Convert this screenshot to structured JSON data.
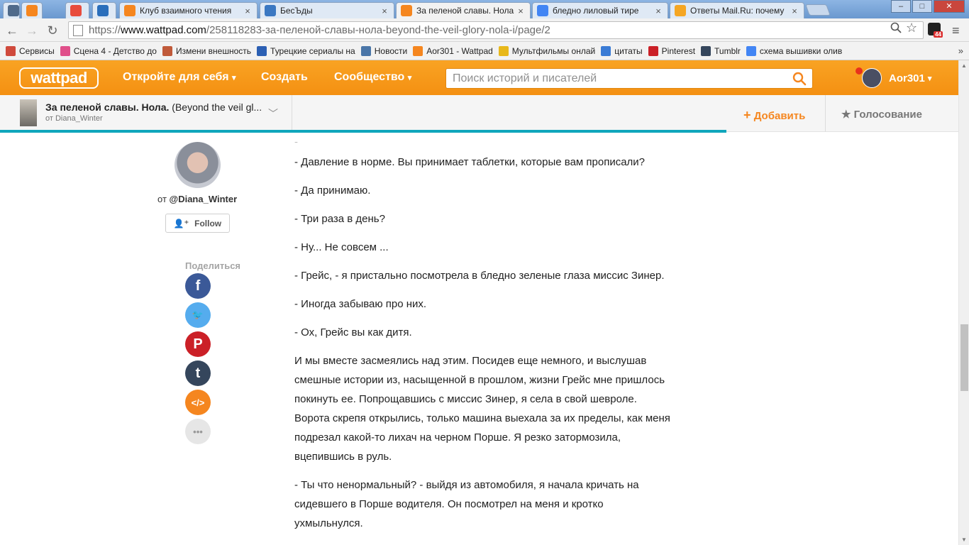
{
  "tabs": [
    {
      "label": "",
      "icon": "da-icon",
      "color": "#4f6a8a"
    },
    {
      "label": "",
      "icon": "wattpad-tab-icon",
      "color": "#f5861f"
    },
    {
      "label": "",
      "icon": "5plus-icon",
      "color": "#e84c3d"
    },
    {
      "label": "",
      "icon": "feather-icon",
      "color": "#2a6ebb"
    },
    {
      "label": "Клуб взаимного чтения",
      "icon": "wattpad-tab-icon",
      "color": "#f5861f"
    },
    {
      "label": "БесЪды",
      "icon": "chat-icon",
      "color": "#3b78c2"
    },
    {
      "label": "За пеленой славы. Нола",
      "icon": "wattpad-tab-icon",
      "color": "#f5861f"
    },
    {
      "label": "бледно лиловый тире",
      "icon": "google-icon",
      "color": "#4285f4"
    },
    {
      "label": "Ответы Mail.Ru: почему",
      "icon": "question-icon",
      "color": "#f5a623"
    }
  ],
  "address": {
    "scheme": "https://",
    "host": "www.wattpad.com",
    "path": "/258118283-за-пеленой-славы-нола-beyond-the-veil-glory-nola-i/page/2"
  },
  "extension_badge": "44",
  "bookmarks": [
    {
      "label": "Сервисы",
      "icon": "apps-icon",
      "color": "#d04a3c"
    },
    {
      "label": "Сцена 4 - Детство до",
      "icon": "heart-icon",
      "color": "#e04f8a"
    },
    {
      "label": "Измени внешность",
      "icon": "cake-icon",
      "color": "#c05a3a"
    },
    {
      "label": "Турецкие сериалы на",
      "icon": "flame-icon",
      "color": "#2b5fb3"
    },
    {
      "label": "Новости",
      "icon": "vk-icon",
      "color": "#4a76a8"
    },
    {
      "label": "Aor301 - Wattpad",
      "icon": "wattpad-bm-icon",
      "color": "#f5861f"
    },
    {
      "label": "Мультфильмы онлай",
      "icon": "smile-icon",
      "color": "#e8b81a"
    },
    {
      "label": "цитаты",
      "icon": "quote-icon",
      "color": "#3a7bd5"
    },
    {
      "label": "Pinterest",
      "icon": "pinterest-icon",
      "color": "#cb2027"
    },
    {
      "label": "Tumblr",
      "icon": "tumblr-icon",
      "color": "#35465c"
    },
    {
      "label": "схема вышивки олив",
      "icon": "google-icon",
      "color": "#4285f4"
    }
  ],
  "wattpad": {
    "logo": "wattpad",
    "nav_discover": "Откройте для себя",
    "nav_create": "Создать",
    "nav_community": "Сообщество",
    "search_placeholder": "Поиск историй и писателей",
    "username": "Aor301",
    "brand_color": "#f5861f"
  },
  "story": {
    "title_bold": "За пеленой славы. Нола.",
    "title_rest": " (Beyond the veil gl...",
    "author_line": "от Diana_Winter",
    "add_label": "Добавить",
    "vote_label": "Голосование"
  },
  "sidebar": {
    "by_prefix": "от ",
    "author_handle": "@Diana_Winter",
    "follow_label": "Follow",
    "share_label": "Поделиться",
    "share_buttons": [
      {
        "icon": "facebook-icon",
        "glyph": "f",
        "color": "#3b5998"
      },
      {
        "icon": "twitter-icon",
        "glyph": "🐦",
        "color": "#55acee"
      },
      {
        "icon": "pinterest-icon",
        "glyph": "P",
        "color": "#cb2027"
      },
      {
        "icon": "tumblr-icon",
        "glyph": "t",
        "color": "#35465c"
      },
      {
        "icon": "embed-icon",
        "glyph": "</>",
        "color": "#f5861f"
      },
      {
        "icon": "more-icon",
        "glyph": "•••",
        "color": "#e6e6e6"
      }
    ]
  },
  "paragraphs": [
    "- Давление в норме. Вы принимает таблетки, которые вам прописали?",
    "- Да принимаю.",
    "- Три раза в день?",
    "- Ну... Не совсем ...",
    "- Грейс, - я пристально посмотрела в бледно зеленые глаза миссис Зинер.",
    "- Иногда забываю про них.",
    "- Ох, Грейс вы как дитя.",
    "И мы вместе засмеялись над этим. Посидев еще немного, и выслушав смешные истории из, насыщенной в прошлом, жизни Грейс мне пришлось покинуть ее. Попрощавшись с миссис Зинер, я села в свой шевроле. Ворота скрепя открылись, только машина выехала за их пределы, как меня подрезал какой-то лихач на черном Порше. Я резко затормозила, вцепившись в руль.",
    "- Ты что ненормальный? - выйдя из автомобиля, я начала кричать на сидевшего в Порше водителя. Он посмотрел на меня и кротко ухмыльнулся."
  ]
}
